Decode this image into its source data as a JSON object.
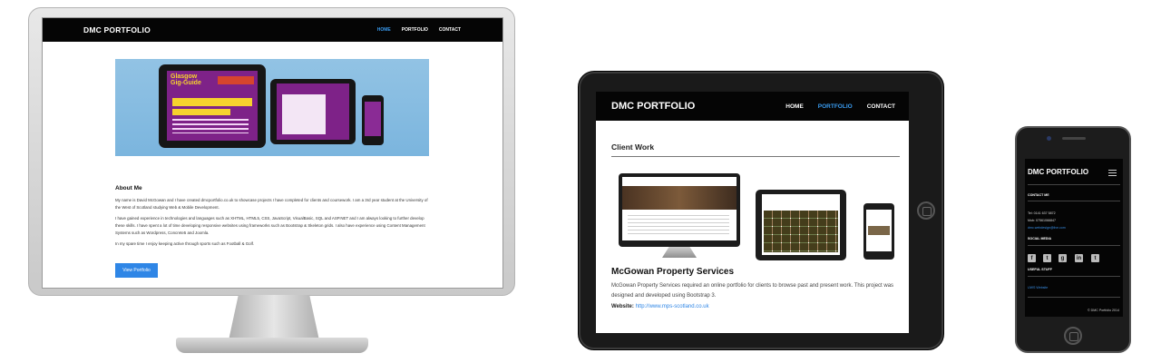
{
  "desktop": {
    "brand": "DMC PORTFOLIO",
    "nav": [
      {
        "label": "HOME",
        "active": true
      },
      {
        "label": "PORTFOLIO",
        "active": false
      },
      {
        "label": "CONTACT",
        "active": false
      }
    ],
    "about_heading": "About Me",
    "paragraphs": [
      "My name is David McGowan and I have created dmcportfolio.co.uk to showcase projects I have completed for clients and coursework. I am a 3rd year student at the University of the West of Scotland studying Web & Mobile Development.",
      "I have gained experience in technologies and languages such as XHTML, HTML5, CSS, JavaScript, VisualBasic, SQL and ASP.NET and I am always looking to further develop these skills. I have spent a lot of time developing responsive websites using frameworks such as Bootstrap & Skeleton grids. I also have experience using Content Management Systems such as Wordpress, Concrete5 and Joomla.",
      "In my spare time I enjoy keeping active through sports such as Football & Golf."
    ],
    "button": "View Portfolio"
  },
  "tablet": {
    "brand": "DMC PORTFOLIO",
    "nav": [
      {
        "label": "HOME",
        "active": false
      },
      {
        "label": "PORTFOLIO",
        "active": true
      },
      {
        "label": "CONTACT",
        "active": false
      }
    ],
    "section_heading": "Client Work",
    "project_title": "McGowan Property Services",
    "project_desc": "McGowan Property Services required an online portfolio for clients to browse past and present work. This project was designed and developed using Bootstrap 3.",
    "website_label": "Website:",
    "website_url": "http://www.mps-scotland.co.uk"
  },
  "phone": {
    "brand": "DMC PORTFOLIO",
    "contact_heading": "CONTACT ME",
    "tel": "Tel: 0141 637 5872",
    "mob": "Mob: 07561066847",
    "email": "dmc.webdesign@live.com",
    "social_heading": "SOCIAL MEDIA",
    "social_icons": [
      "facebook-icon",
      "twitter-icon",
      "google-plus-icon",
      "linkedin-icon",
      "tumblr-icon"
    ],
    "useful_heading": "USEFUL STUFF",
    "useful_link": "UWS Website",
    "copyright": "© DMC Portfolio 2014"
  }
}
